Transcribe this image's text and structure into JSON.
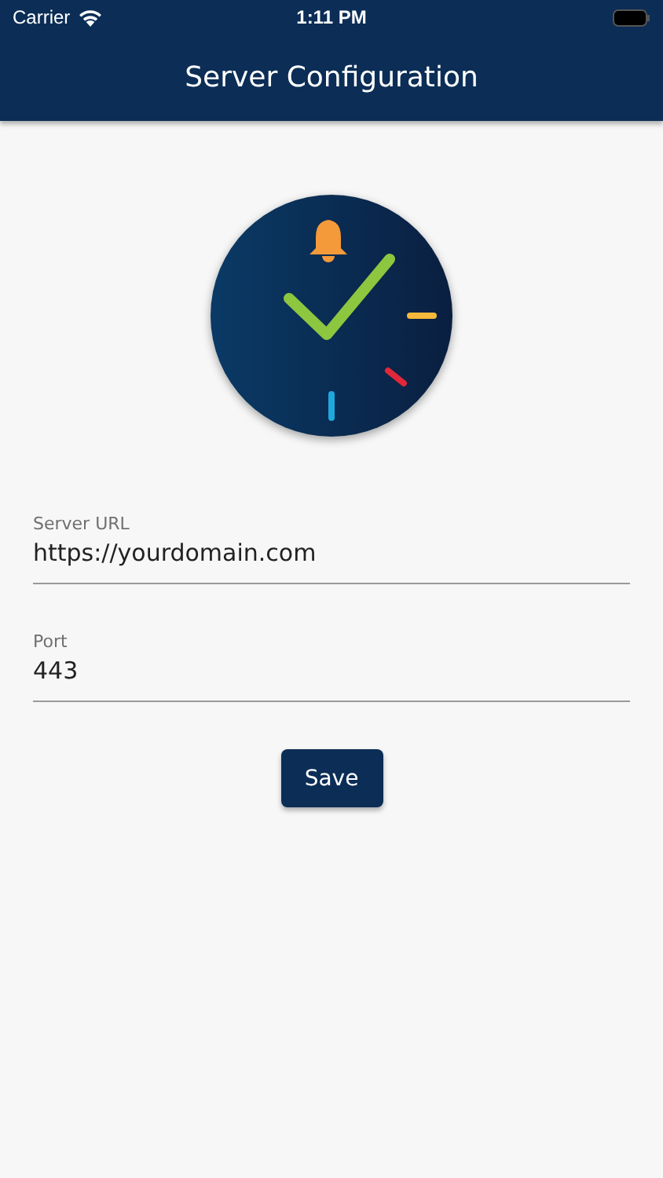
{
  "status_bar": {
    "carrier": "Carrier",
    "time": "1:11 PM"
  },
  "nav_bar": {
    "title": "Server Configuration"
  },
  "logo": {
    "kind": "clock-logo"
  },
  "fields": [
    {
      "label": "Server URL",
      "value": "https://yourdomain.com"
    },
    {
      "label": "Port",
      "value": "443"
    }
  ],
  "save_button": {
    "label": "Save"
  }
}
